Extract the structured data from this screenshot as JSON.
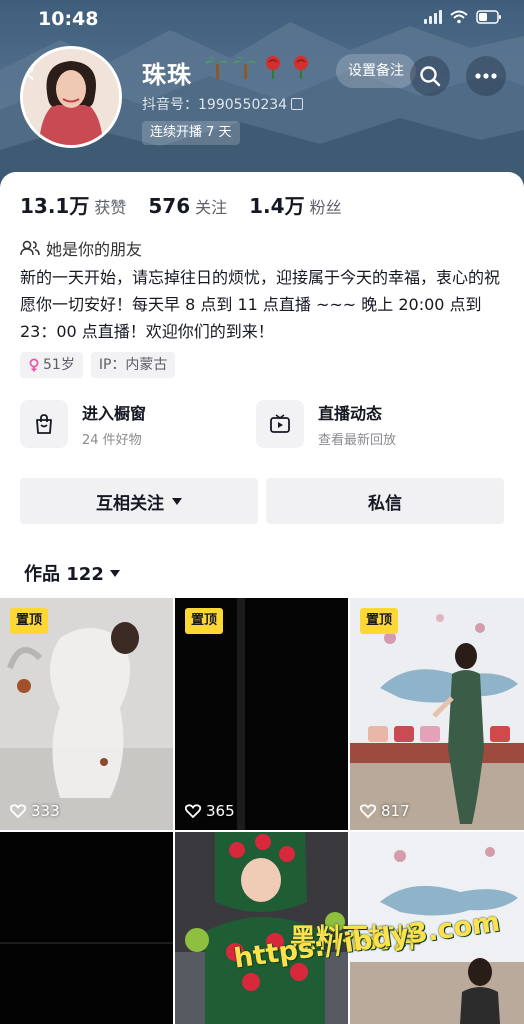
{
  "status_bar": {
    "time": "10:48"
  },
  "profile": {
    "name": "珠珠",
    "douyin_id": "抖音号：1990550234",
    "live_badge": "连续开播 7 天",
    "remark_button": "设置备注"
  },
  "stats": [
    {
      "value": "13.1万",
      "label": "获赞"
    },
    {
      "value": "576",
      "label": "关注"
    },
    {
      "value": "1.4万",
      "label": "粉丝"
    }
  ],
  "friend_text": "她是你的朋友",
  "bio": "新的一天开始，请忘掉往日的烦忧，迎接属于今天的幸福，衷心的祝愿你一切安好！每天早 8 点到 11 点直播 ~~~ 晚上 20:00 点到 23：00 点直播！欢迎你们的到来！",
  "tags": {
    "age": "51岁",
    "ip": "IP：内蒙古"
  },
  "entries": [
    {
      "title": "进入橱窗",
      "sub": "24 件好物",
      "icon": "shopping-bag-icon"
    },
    {
      "title": "直播动态",
      "sub": "查看最新回放",
      "icon": "tv-icon"
    }
  ],
  "actions": {
    "follow": "互相关注",
    "message": "私信"
  },
  "works": {
    "label": "作品 122"
  },
  "videos": [
    {
      "pinned": "置顶",
      "likes": "333"
    },
    {
      "pinned": "置顶",
      "likes": "365"
    },
    {
      "pinned": "置顶",
      "likes": "817"
    },
    {
      "likes": ""
    },
    {
      "likes": ""
    },
    {
      "likes": ""
    }
  ],
  "watermark": {
    "line1": "黑料不打烊",
    "line2": "https://ibdy3.com"
  },
  "colors": {
    "accent": "#fe2c55",
    "pin": "#fdd835",
    "header": "#5f7d97"
  }
}
